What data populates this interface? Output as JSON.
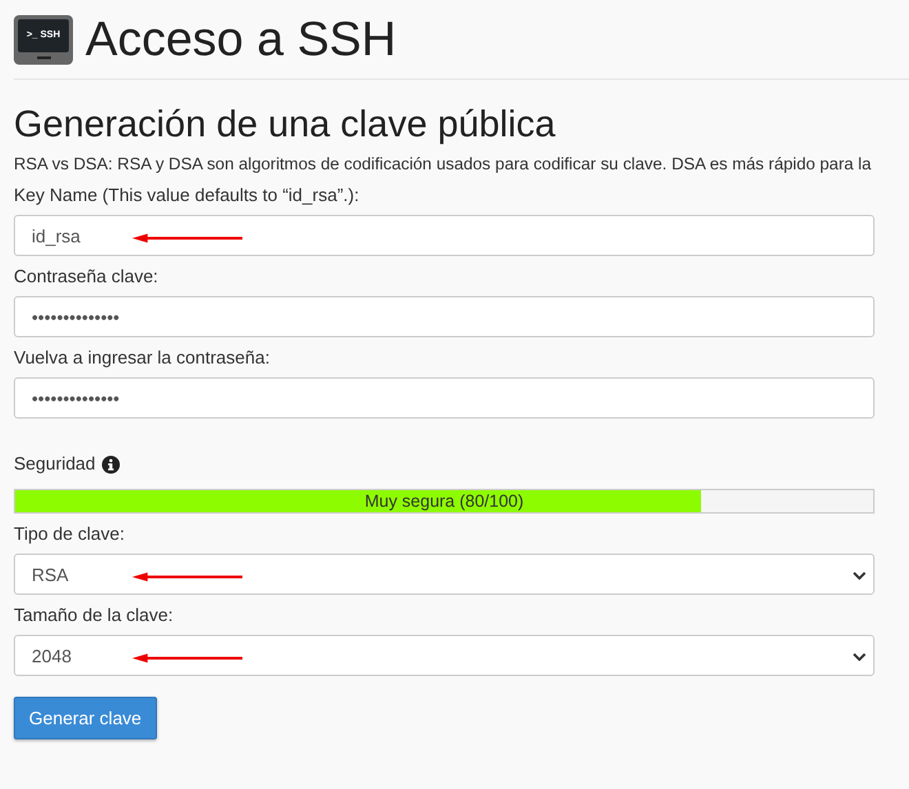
{
  "header": {
    "title": "Acceso a SSH",
    "icon_text": ">_ SSH"
  },
  "section": {
    "title": "Generación de una clave pública",
    "description": "RSA vs DSA: RSA y DSA son algoritmos de codificación usados para codificar su clave. DSA es más rápido para la"
  },
  "fields": [
    {
      "kind": "text",
      "label": "Key Name (This value defaults to “id_rsa”.):",
      "value": "id_rsa",
      "annotated": true
    },
    {
      "kind": "text",
      "label": "Contraseña clave:",
      "value": "••••••••••••••",
      "annotated": false
    },
    {
      "kind": "text",
      "label": "Vuelva a ingresar la contraseña:",
      "value": "••••••••••••••",
      "annotated": false
    },
    {
      "kind": "meter",
      "label": "Seguridad",
      "reading": "Muy segura (80/100)",
      "level": 0.8
    },
    {
      "kind": "select",
      "label": "Tipo de clave:",
      "value": "RSA",
      "annotated": true
    },
    {
      "kind": "select",
      "label": "Tamaño de la clave:",
      "value": "2048",
      "annotated": true
    }
  ],
  "button": {
    "label": "Generar clave"
  }
}
